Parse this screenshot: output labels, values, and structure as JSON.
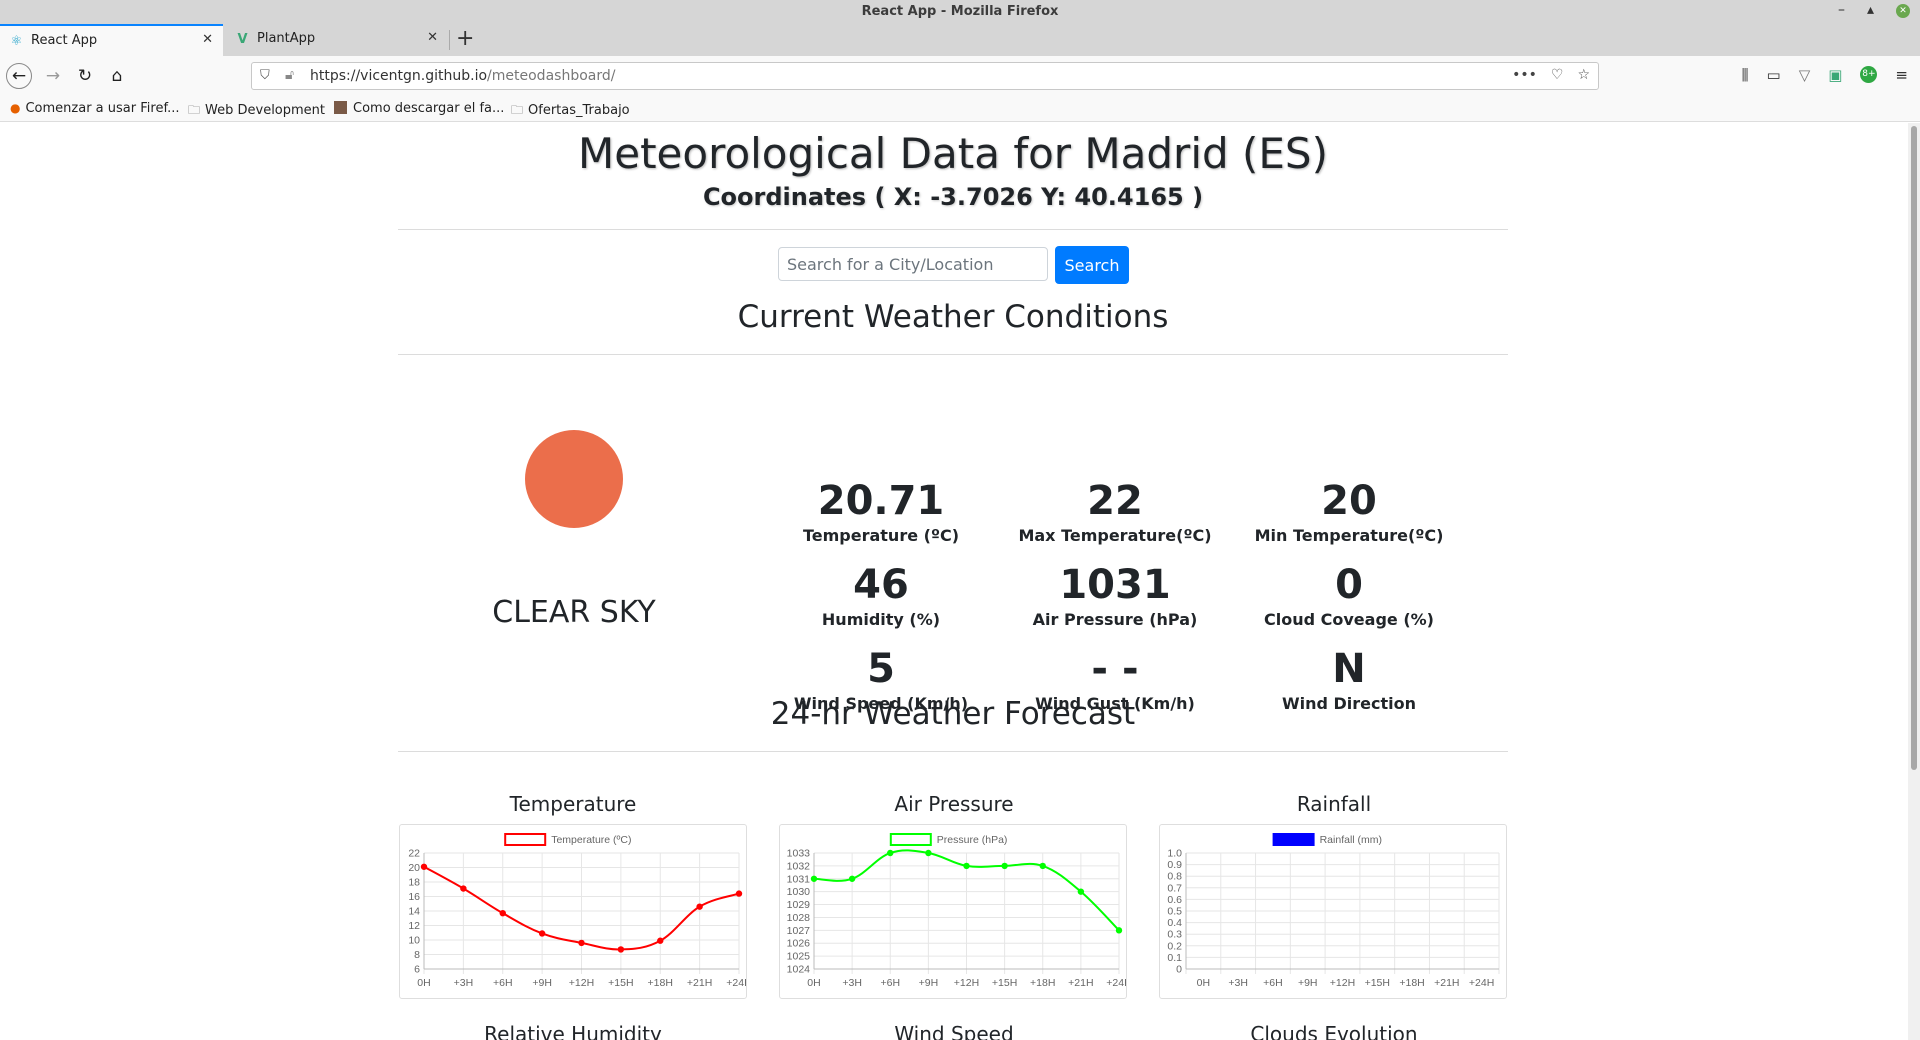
{
  "window": {
    "title": "React App - Mozilla Firefox"
  },
  "tabs": [
    {
      "label": "React App",
      "icon": "react-icon",
      "active": true
    },
    {
      "label": "PlantApp",
      "icon": "vue-icon",
      "active": false
    }
  ],
  "nav": {
    "url_host": "https://vicentgn.github.io",
    "url_path": "/meteodashboard/"
  },
  "bookmarks": [
    {
      "label": "Comenzar a usar Firef...",
      "icon": "firefox-icon"
    },
    {
      "label": "Web Development",
      "icon": "folder-icon"
    },
    {
      "label": "Como descargar el fa...",
      "icon": "thumbnail-icon"
    },
    {
      "label": "Ofertas_Trabajo",
      "icon": "folder-icon"
    }
  ],
  "header": {
    "title": "Meteorological Data for Madrid (ES)",
    "coordinates": "Coordinates ( X: -3.7026 Y: 40.4165 )"
  },
  "search": {
    "placeholder": "Search for a City/Location",
    "value": "",
    "button": "Search"
  },
  "current": {
    "section_title": "Current Weather Conditions",
    "condition": "CLEAR SKY",
    "icon": "sun-icon",
    "sun_color": "#eb6e4b",
    "metrics": [
      {
        "value": "20.71",
        "label": "Temperature (ºC)"
      },
      {
        "value": "22",
        "label": "Max Temperature(ºC)"
      },
      {
        "value": "20",
        "label": "Min Temperature(ºC)"
      },
      {
        "value": "46",
        "label": "Humidity (%)"
      },
      {
        "value": "1031",
        "label": "Air Pressure (hPa)"
      },
      {
        "value": "0",
        "label": "Cloud Coveage (%)"
      },
      {
        "value": "5",
        "label": "Wind Speed (Km/h)"
      },
      {
        "value": "- -",
        "label": "Wind Gust (Km/h)"
      },
      {
        "value": "N",
        "label": "Wind Direction"
      }
    ]
  },
  "forecast": {
    "section_title": "24-hr Weather Forecast",
    "next_row_titles": [
      "Relative Humidity",
      "Wind Speed",
      "Clouds Evolution"
    ]
  },
  "chart_data": [
    {
      "type": "line",
      "title": "Temperature",
      "categories": [
        "0H",
        "+3H",
        "+6H",
        "+9H",
        "+12H",
        "+15H",
        "+18H",
        "+21H",
        "+24H"
      ],
      "series": [
        {
          "name": "Temperature (ºC)",
          "color": "#ff0000",
          "values": [
            20.1,
            17.1,
            13.7,
            10.9,
            9.6,
            8.7,
            9.9,
            14.6,
            16.4
          ]
        }
      ],
      "ylim": [
        6,
        22
      ],
      "yticks": [
        22,
        20,
        18,
        16,
        14,
        12,
        10,
        8,
        6
      ],
      "legend": "top"
    },
    {
      "type": "line",
      "title": "Air Pressure",
      "categories": [
        "0H",
        "+3H",
        "+6H",
        "+9H",
        "+12H",
        "+15H",
        "+18H",
        "+21H",
        "+24H"
      ],
      "series": [
        {
          "name": "Pressure (hPa)",
          "color": "#00ff00",
          "values": [
            1031,
            1031,
            1033,
            1033,
            1032,
            1032,
            1032,
            1030,
            1027
          ]
        }
      ],
      "ylim": [
        1024,
        1033
      ],
      "yticks": [
        1033,
        1032,
        1031,
        1030,
        1029,
        1028,
        1027,
        1026,
        1025,
        1024
      ],
      "legend": "top"
    },
    {
      "type": "bar",
      "title": "Rainfall",
      "categories": [
        "0H",
        "+3H",
        "+6H",
        "+9H",
        "+12H",
        "+15H",
        "+18H",
        "+21H",
        "+24H"
      ],
      "series": [
        {
          "name": "Rainfall (mm)",
          "color": "#0000ff",
          "values": [
            0,
            0,
            0,
            0,
            0,
            0,
            0,
            0,
            0
          ]
        }
      ],
      "ylim": [
        0,
        1.0
      ],
      "yticks": [
        "1.0",
        "0.9",
        "0.8",
        "0.7",
        "0.6",
        "0.5",
        "0.4",
        "0.3",
        "0.2",
        "0.1",
        "0"
      ],
      "legend": "top"
    }
  ]
}
